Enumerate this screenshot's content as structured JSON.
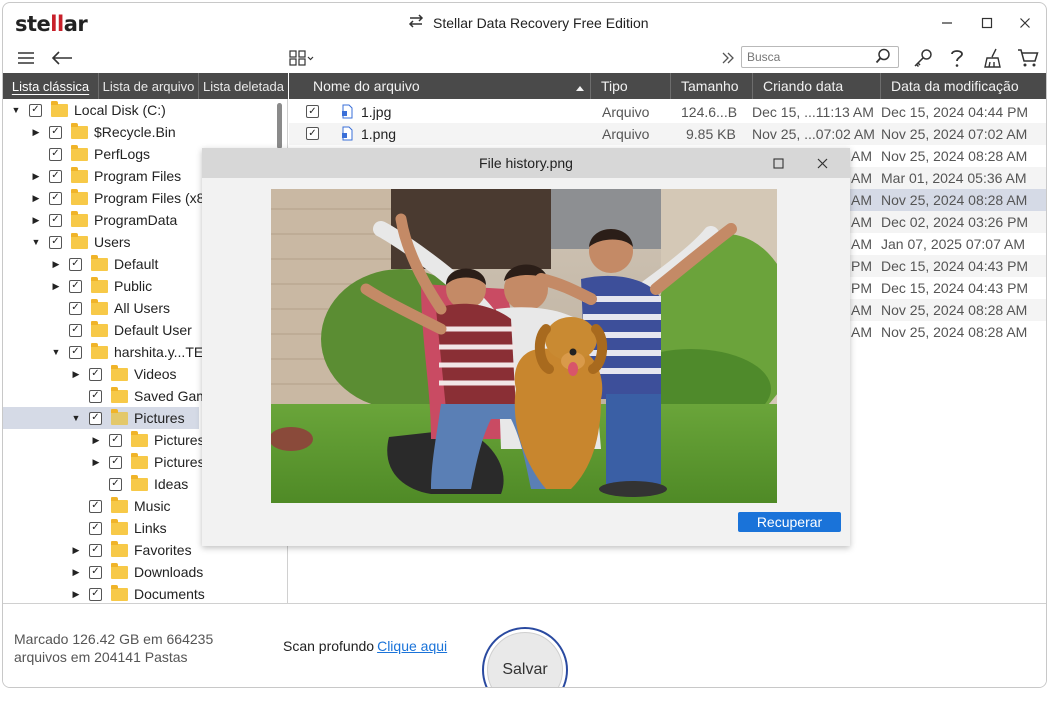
{
  "app": {
    "logo": {
      "pre": "ste",
      "mid": "ll",
      "post": "ar"
    },
    "title": "Stellar Data Recovery Free Edition"
  },
  "toolbar": {
    "search_placeholder": "Busca"
  },
  "tabs": [
    "Lista clássica",
    "Lista de arquivo",
    "Lista deletada"
  ],
  "tree": [
    {
      "label": "Local Disk (C:)",
      "arrow": "down"
    },
    {
      "label": "$Recycle.Bin",
      "arrow": "right"
    },
    {
      "label": "PerfLogs",
      "arrow": ""
    },
    {
      "label": "Program Files",
      "arrow": "right"
    },
    {
      "label": "Program Files (x86)",
      "arrow": "right"
    },
    {
      "label": "ProgramData",
      "arrow": "right"
    },
    {
      "label": "Users",
      "arrow": "down"
    },
    {
      "label": "Default",
      "arrow": "right"
    },
    {
      "label": "Public",
      "arrow": "right"
    },
    {
      "label": "All Users",
      "arrow": ""
    },
    {
      "label": "Default User",
      "arrow": ""
    },
    {
      "label": "harshita.y...TE",
      "arrow": "down"
    },
    {
      "label": "Videos",
      "arrow": "right"
    },
    {
      "label": "Saved Games",
      "arrow": ""
    },
    {
      "label": "Pictures",
      "arrow": "down"
    },
    {
      "label": "Pictures",
      "arrow": "right"
    },
    {
      "label": "Pictures",
      "arrow": "right"
    },
    {
      "label": "Ideas",
      "arrow": ""
    },
    {
      "label": "Music",
      "arrow": ""
    },
    {
      "label": "Links",
      "arrow": ""
    },
    {
      "label": "Favorites",
      "arrow": "right"
    },
    {
      "label": "Downloads",
      "arrow": "right"
    },
    {
      "label": "Documents",
      "arrow": "right"
    }
  ],
  "columns": [
    "Nome do arquivo",
    "Tipo",
    "Tamanho",
    "Criando data",
    "Data da modificação"
  ],
  "files": [
    {
      "name": "1.jpg",
      "type": "Arquivo",
      "size": "124.6...B",
      "created": "Dec 15, ...11:13 AM",
      "modified": "Dec 15, 2024 04:44 PM"
    },
    {
      "name": "1.png",
      "type": "Arquivo",
      "size": "9.85 KB",
      "created": "Nov 25, ...07:02 AM",
      "modified": "Nov 25, 2024 07:02 AM"
    },
    {
      "created_tail": "AM",
      "modified": "Nov 25, 2024 08:28 AM"
    },
    {
      "created_tail": "AM",
      "modified": "Mar 01, 2024 05:36 AM"
    },
    {
      "created_tail": "AM",
      "modified": "Nov 25, 2024 08:28 AM"
    },
    {
      "created_tail": "AM",
      "modified": "Dec 02, 2024 03:26 PM"
    },
    {
      "created_tail": "AM",
      "modified": "Jan 07, 2025 07:07 AM"
    },
    {
      "created_tail": "PM",
      "modified": "Dec 15, 2024 04:43 PM"
    },
    {
      "created_tail": "PM",
      "modified": "Dec 15, 2024 04:43 PM"
    },
    {
      "created_tail": "AM",
      "modified": "Nov 25, 2024 08:28 AM"
    },
    {
      "created_tail": "AM",
      "modified": "Nov 25, 2024 08:28 AM"
    }
  ],
  "preview": {
    "title": "File history.png",
    "recover_label": "Recuperar",
    "image_description": "family-photo"
  },
  "footer": {
    "status_line1": "Marcado 126.42 GB em 664235",
    "status_line2": "arquivos em 204141 Pastas",
    "deep_scan_label": "Scan profundo",
    "deep_scan_link": "Clique aqui",
    "save_label": "Salvar"
  },
  "colors": {
    "header_bg": "#4a4a4a",
    "selection": "#d5dae6",
    "accent_blue": "#1a73d9",
    "logo_red": "#c8202a",
    "folder": "#f7c948"
  }
}
